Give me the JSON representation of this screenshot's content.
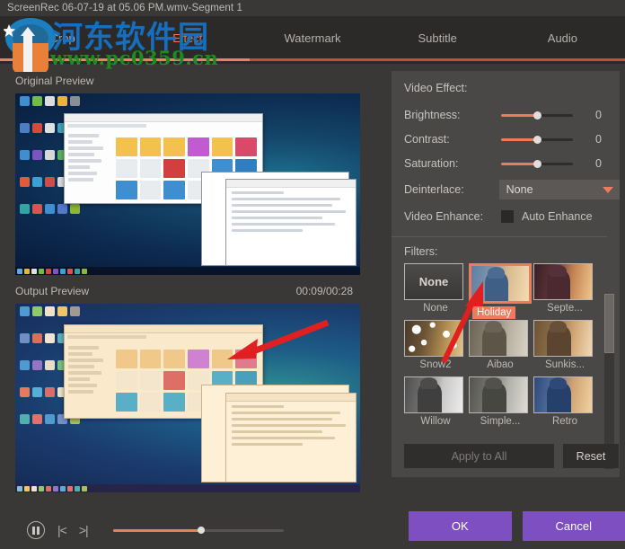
{
  "window": {
    "title": "ScreenRec 06-07-19 at 05.06 PM.wmv-Segment 1"
  },
  "tabs": [
    {
      "label": "Crop",
      "active": false
    },
    {
      "label": "Effect",
      "active": true
    },
    {
      "label": "Watermark",
      "active": false
    },
    {
      "label": "Subtitle",
      "active": false
    },
    {
      "label": "Audio",
      "active": false
    }
  ],
  "previews": {
    "original_label": "Original Preview",
    "output_label": "Output Preview",
    "timecode": "00:09/00:28"
  },
  "playback": {
    "pause_icon": "pause-icon",
    "prev_label": "|<",
    "next_label": ">|",
    "progress_percent": "52"
  },
  "effects": {
    "section_label": "Video Effect:",
    "rows": [
      {
        "label": "Brightness:",
        "value": "0",
        "slider_percent": "50"
      },
      {
        "label": "Contrast:",
        "value": "0",
        "slider_percent": "50"
      },
      {
        "label": "Saturation:",
        "value": "0",
        "slider_percent": "50"
      }
    ],
    "deinterlace": {
      "label": "Deinterlace:",
      "value": "None"
    },
    "video_enhance": {
      "label": "Video Enhance:",
      "checkbox_label": "Auto Enhance",
      "checked": false
    }
  },
  "filters": {
    "section_label": "Filters:",
    "items": [
      {
        "name": "None",
        "thumb": "none",
        "selected": false
      },
      {
        "name": "Holiday",
        "thumb": "holiday",
        "selected": true
      },
      {
        "name": "Septe...",
        "thumb": "septe",
        "selected": false
      },
      {
        "name": "Snow2",
        "thumb": "snow2",
        "selected": false
      },
      {
        "name": "Aibao",
        "thumb": "aibao",
        "selected": false
      },
      {
        "name": "Sunkis...",
        "thumb": "sunkis",
        "selected": false
      },
      {
        "name": "Willow",
        "thumb": "willow",
        "selected": false
      },
      {
        "name": "Simple...",
        "thumb": "simple",
        "selected": false
      },
      {
        "name": "Retro",
        "thumb": "retro",
        "selected": false
      }
    ],
    "none_thumb_label": "None"
  },
  "buttons": {
    "apply_to_all": "Apply to All",
    "reset": "Reset",
    "ok": "OK",
    "cancel": "Cancel"
  },
  "watermark": {
    "chinese": "河东软件园",
    "url": "www.pc0359.cn"
  },
  "colors": {
    "accent": "#ef7b5d",
    "purple": "#7d4fc0",
    "panel": "#4a4846",
    "app_bg": "#3a3836",
    "title_bg": "#3a3836"
  }
}
